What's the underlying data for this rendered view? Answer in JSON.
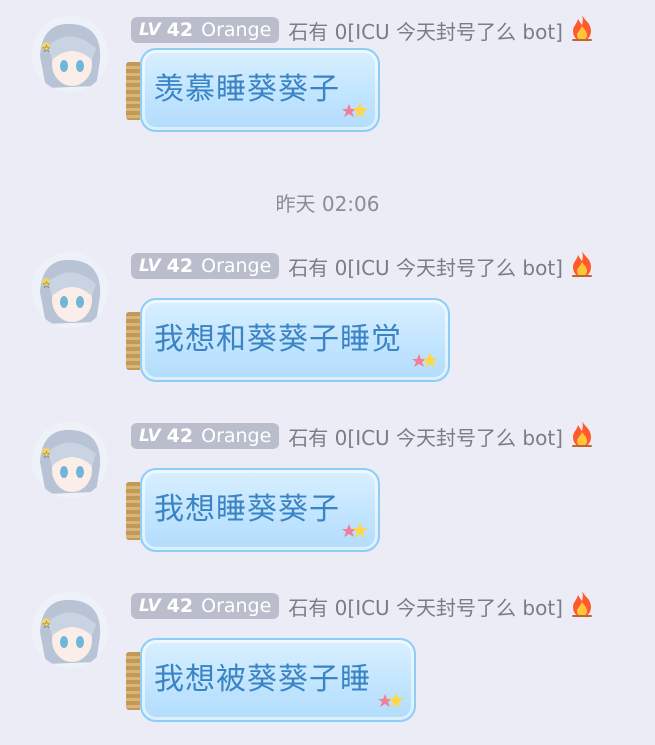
{
  "timestamp": "昨天 02:06",
  "messages": [
    {
      "level_prefix": "LV",
      "level": "42",
      "title": "Orange",
      "nickname": "石有 0[ICU 今天封号了么 bot]",
      "text": "羡慕睡葵葵子"
    },
    {
      "level_prefix": "LV",
      "level": "42",
      "title": "Orange",
      "nickname": "石有 0[ICU 今天封号了么 bot]",
      "text": "我想和葵葵子睡觉"
    },
    {
      "level_prefix": "LV",
      "level": "42",
      "title": "Orange",
      "nickname": "石有 0[ICU 今天封号了么 bot]",
      "text": "我想睡葵葵子"
    },
    {
      "level_prefix": "LV",
      "level": "42",
      "title": "Orange",
      "nickname": "石有 0[ICU 今天封号了么 bot]",
      "text": "我想被葵葵子睡"
    }
  ],
  "colors": {
    "background": "#ececf6",
    "bubble_text": "#3a83c4",
    "badge": "#b9bdcc",
    "nickname": "#7a7c86"
  },
  "icons": {
    "fire": "fire-icon",
    "stars": "star-sticker-icon"
  }
}
